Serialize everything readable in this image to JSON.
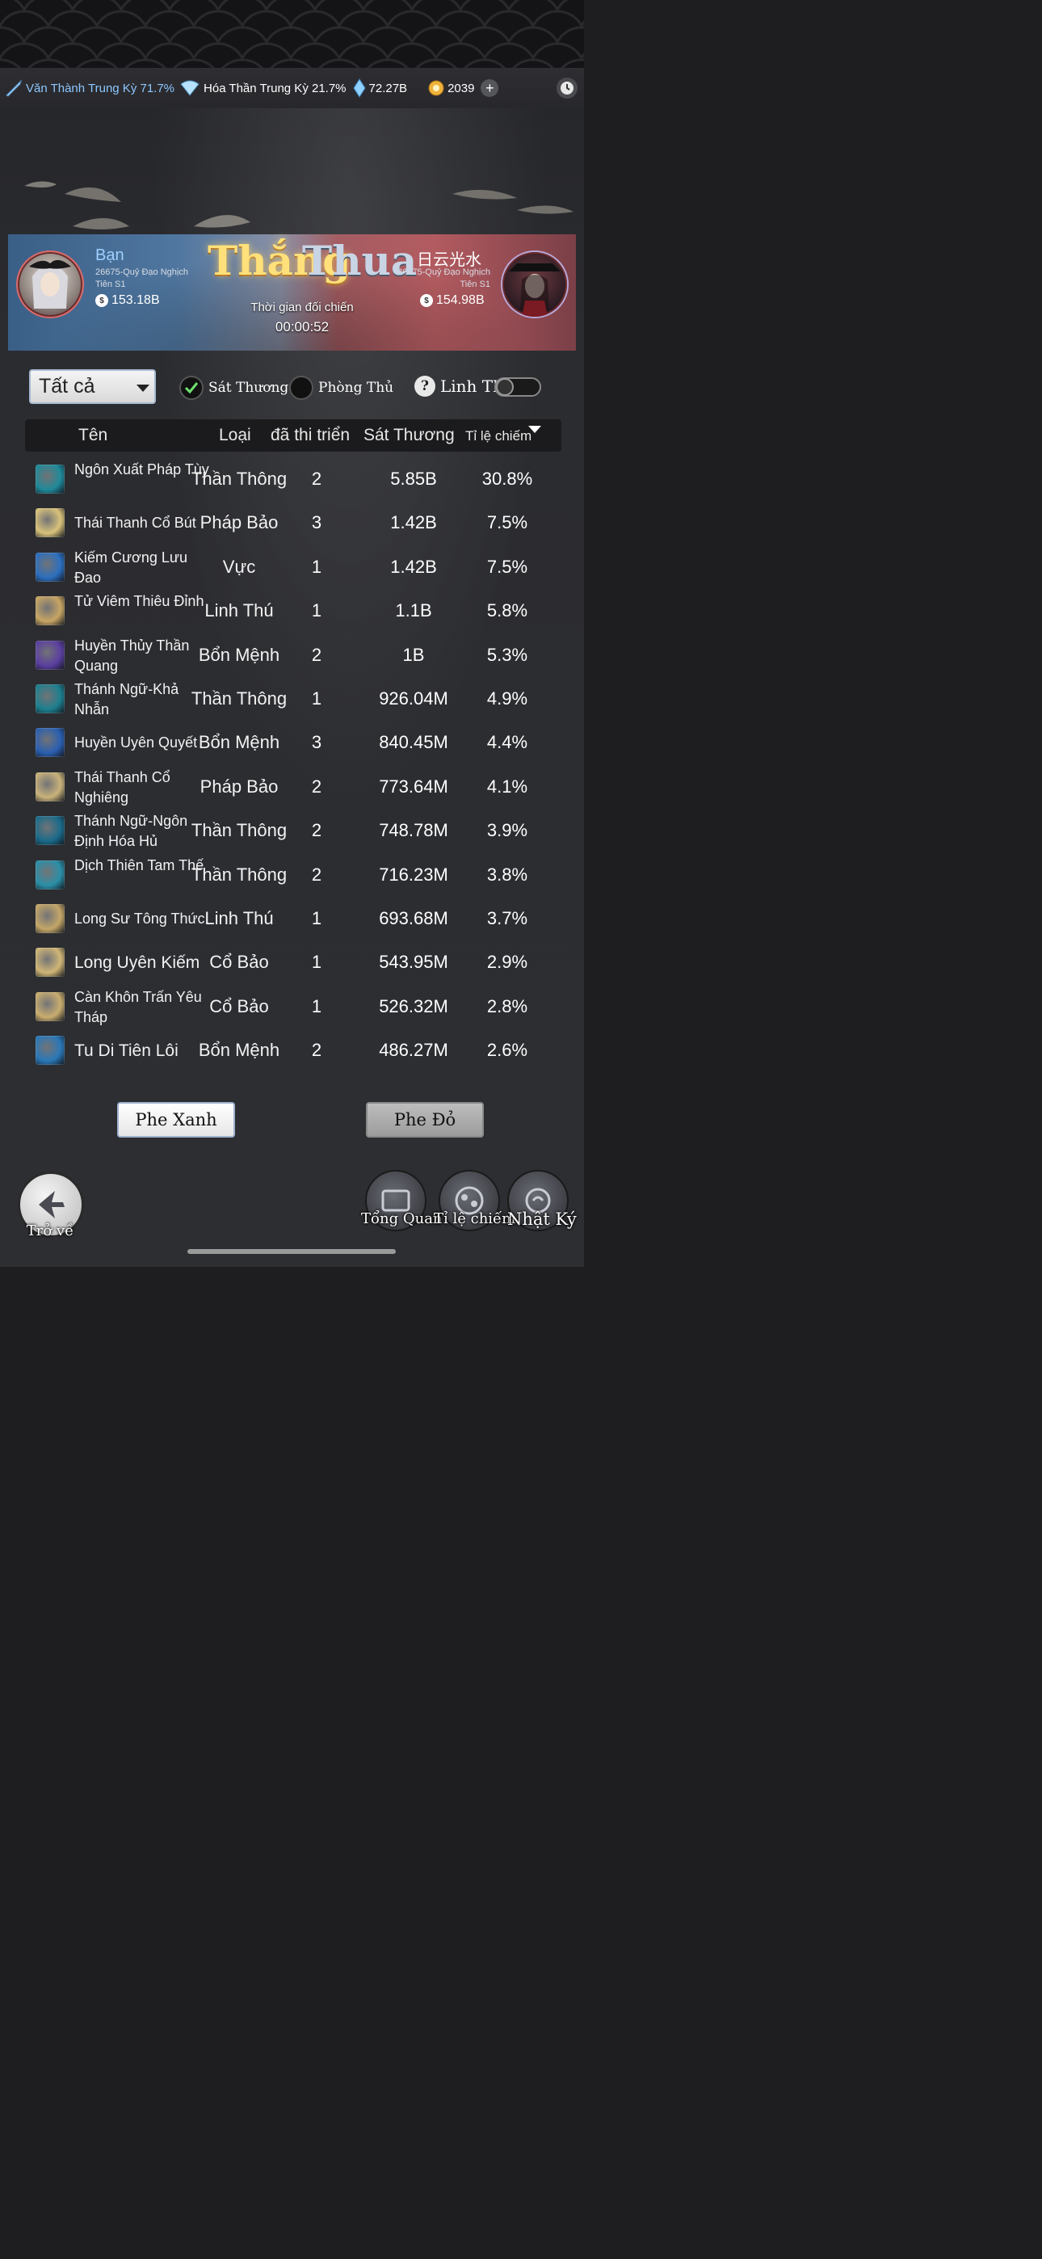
{
  "resources": {
    "realm1": "Văn Thành Trung Kỳ 71.7%",
    "realm2": "Hóa Thần Trung Kỳ 21.7%",
    "crystal": "72.27B",
    "gold": "2039",
    "plus": "+"
  },
  "battle": {
    "left_player": {
      "name": "Bạn",
      "server": "26675-Quỷ Đạo Nghịch Tiên S1",
      "power": "153.18B"
    },
    "right_player": {
      "name": "日云光水",
      "server": "26675-Quỷ Đạo Nghịch Tiên S1",
      "power": "154.98B"
    },
    "result_win": "Thắng",
    "result_lose": "Thua",
    "time_label": "Thời gian đối chiến",
    "time_value": "00:00:52"
  },
  "filters": {
    "dropdown_value": "Tất cả",
    "damage_label": "Sát Thương",
    "defense_label": "Phòng Thủ",
    "help": "?",
    "pet_label": "Linh Thú",
    "damage_checked": true,
    "defense_checked": false,
    "pet_toggle_on": false
  },
  "table": {
    "headers": [
      "Tên",
      "Loại",
      "đã thi triển",
      "Sát Thương",
      "Tỉ lệ chiếm"
    ],
    "rows": [
      {
        "name": "Ngôn Xuất Pháp Tùy",
        "type": "Thần Thông",
        "count": "2",
        "damage": "5.85B",
        "pct": "30.8%",
        "icon": "lightning-skill-icon",
        "color": "#1f8a9a"
      },
      {
        "name": "Thái Thanh Cổ Bút",
        "type": "Pháp Bảo",
        "count": "3",
        "damage": "1.42B",
        "pct": "7.5%",
        "icon": "brush-treasure-icon",
        "color": "#d9c27a"
      },
      {
        "name": "Kiếm Cương Lưu Đao",
        "type": "Vực",
        "count": "1",
        "damage": "1.42B",
        "pct": "7.5%",
        "icon": "sword-domain-icon",
        "color": "#2b6fbf"
      },
      {
        "name": "Tử Viêm Thiêu Đỉnh",
        "type": "Linh Thú",
        "count": "1",
        "damage": "1.1B",
        "pct": "5.8%",
        "icon": "beast-icon",
        "color": "#c7a563"
      },
      {
        "name": "Huyền Thủy Thần Quang",
        "type": "Bổn Mệnh",
        "count": "2",
        "damage": "1B",
        "pct": "5.3%",
        "icon": "orb-icon",
        "color": "#5b3fa0"
      },
      {
        "name": "Thánh Ngữ-Khả Nhẫn",
        "type": "Thần Thông",
        "count": "1",
        "damage": "926.04M",
        "pct": "4.9%",
        "icon": "slash-skill-icon",
        "color": "#1d7f8f"
      },
      {
        "name": "Huyền Uyên Quyết",
        "type": "Bổn Mệnh",
        "count": "3",
        "damage": "840.45M",
        "pct": "4.4%",
        "icon": "vortex-icon",
        "color": "#2a5fb0"
      },
      {
        "name": "Thái Thanh Cổ Nghiêng",
        "type": "Pháp Bảo",
        "count": "2",
        "damage": "773.64M",
        "pct": "4.1%",
        "icon": "inkstone-icon",
        "color": "#c9b27a"
      },
      {
        "name": "Thánh Ngữ-Ngôn Định Hóa Hủ",
        "type": "Thần Thông",
        "count": "2",
        "damage": "748.78M",
        "pct": "3.9%",
        "icon": "storm-skill-icon",
        "color": "#1a6b8a"
      },
      {
        "name": "Dịch Thiên Tam Thế",
        "type": "Thần Thông",
        "count": "2",
        "damage": "716.23M",
        "pct": "3.8%",
        "icon": "ice-skill-icon",
        "color": "#2a8fa8"
      },
      {
        "name": "Long Sư Tông Thức",
        "type": "Linh Thú",
        "count": "1",
        "damage": "693.68M",
        "pct": "3.7%",
        "icon": "lion-beast-icon",
        "color": "#c4a668"
      },
      {
        "name": "Long Uyên Kiếm",
        "type": "Cổ Bảo",
        "count": "1",
        "damage": "543.95M",
        "pct": "2.9%",
        "icon": "sword-treasure-icon",
        "color": "#d0b676"
      },
      {
        "name": "Càn Khôn Trấn Yêu Tháp",
        "type": "Cổ Bảo",
        "count": "1",
        "damage": "526.32M",
        "pct": "2.8%",
        "icon": "tower-treasure-icon",
        "color": "#c9ad6f"
      },
      {
        "name": "Tu Di Tiên Lôi",
        "type": "Bổn Mệnh",
        "count": "2",
        "damage": "486.27M",
        "pct": "2.6%",
        "icon": "thunder-icon",
        "color": "#2a78b8"
      }
    ]
  },
  "buttons": {
    "blue_side": "Phe Xanh",
    "red_side": "Phe Đỏ"
  },
  "bottom_nav": {
    "back": "Trở về",
    "overview": "Tổng Quan",
    "ratio": "Tỉ lệ chiếm",
    "log": "Nhật Ký"
  }
}
